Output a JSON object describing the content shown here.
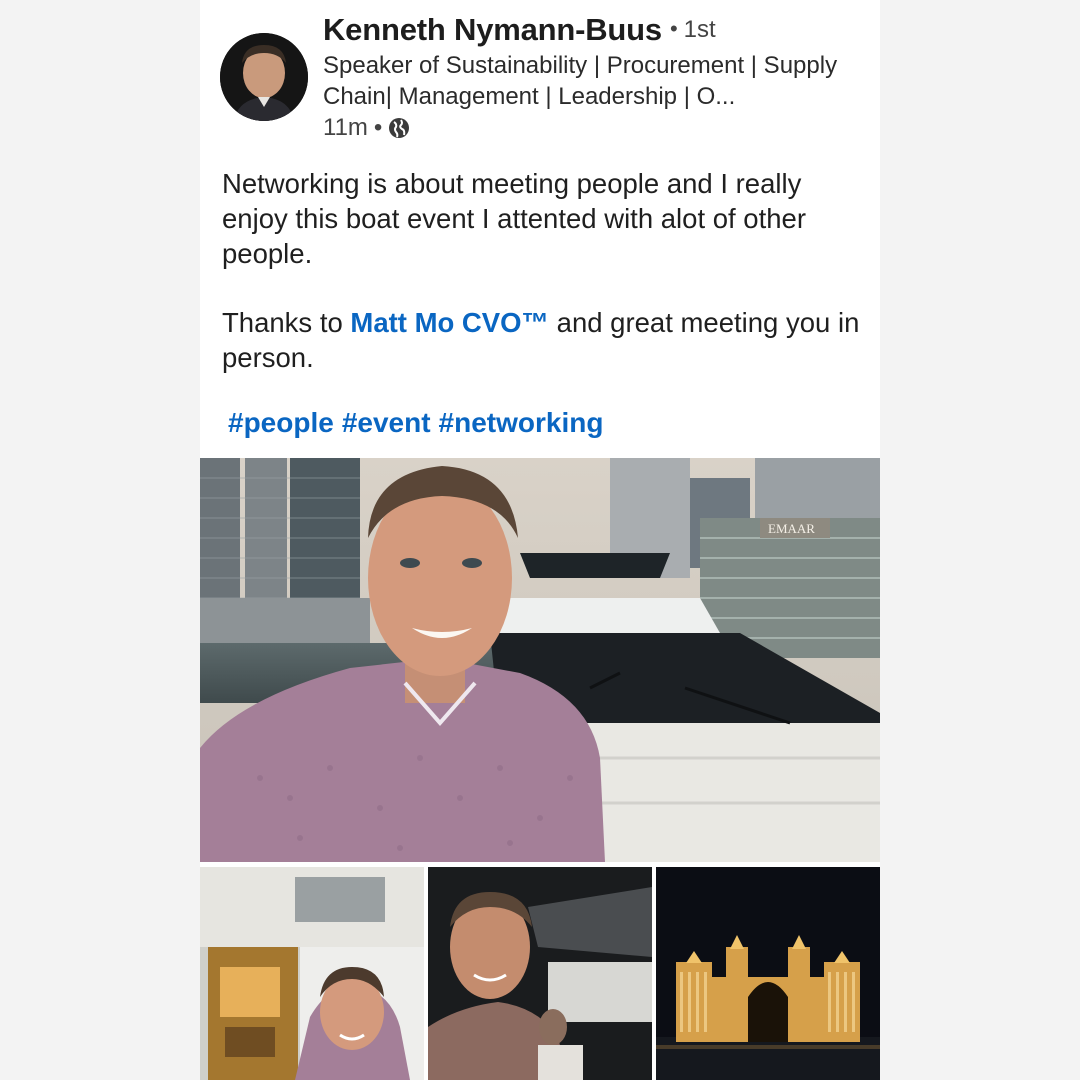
{
  "post": {
    "author_name": "Kenneth Nymann-Buus",
    "degree": "1st",
    "headline": "Speaker of Sustainability | Procurement | Supply Chain| Management | Leadership | O...",
    "time": "11m",
    "paragraph1": "Networking is about meeting people and I really enjoy this boat event I attented with alot of other people.",
    "thanks_prefix": "Thanks to",
    "mention": "Matt Mo CVO™",
    "thanks_suffix": "and great meeting you in person.",
    "hashtags": [
      "#people",
      "#event",
      "#networking"
    ]
  },
  "images": {
    "main_sign_text": "EMAAR"
  },
  "icons": {
    "avatar": "avatar",
    "visibility": "globe-icon"
  },
  "colors": {
    "link": "#0a66c2",
    "background": "#f3f3f3",
    "card": "#ffffff"
  }
}
